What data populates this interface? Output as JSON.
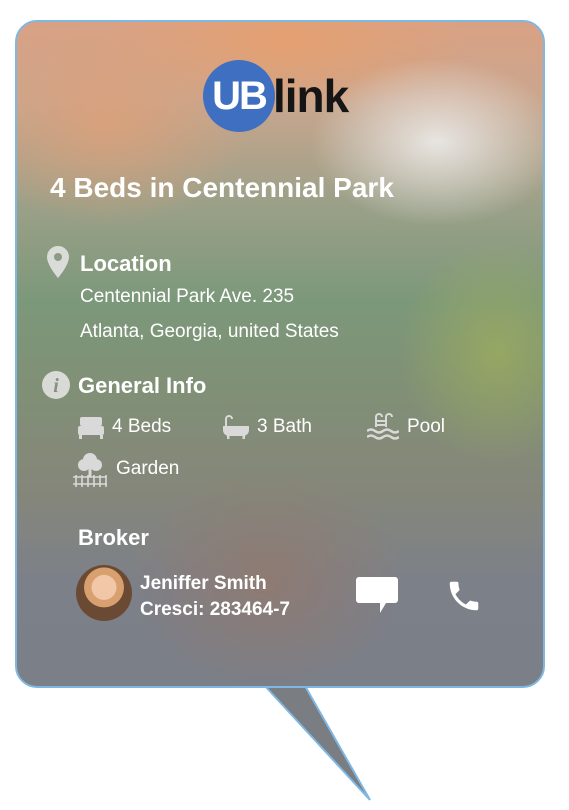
{
  "brand": {
    "circle_text": "UB",
    "text": "link",
    "circle_color": "#3f6fc1"
  },
  "listing": {
    "title": "4 Beds in Centennial Park"
  },
  "location": {
    "heading": "Location",
    "line1": "Centennial Park Ave. 235",
    "line2": "Atlanta, Georgia, united States"
  },
  "general_info": {
    "heading": "General Info",
    "features": [
      {
        "icon": "bed-icon",
        "label": "4 Beds"
      },
      {
        "icon": "bathtub-icon",
        "label": "3 Bath"
      },
      {
        "icon": "pool-icon",
        "label": "Pool"
      },
      {
        "icon": "garden-icon",
        "label": "Garden"
      }
    ]
  },
  "broker": {
    "heading": "Broker",
    "name": "Jeniffer Smith",
    "cresci": "Cresci: 283464-7",
    "actions": [
      {
        "icon": "chat-icon"
      },
      {
        "icon": "phone-icon"
      }
    ]
  },
  "colors": {
    "card_border": "#7fb7e3",
    "tail": "#7a7d82",
    "text": "#ffffff"
  }
}
